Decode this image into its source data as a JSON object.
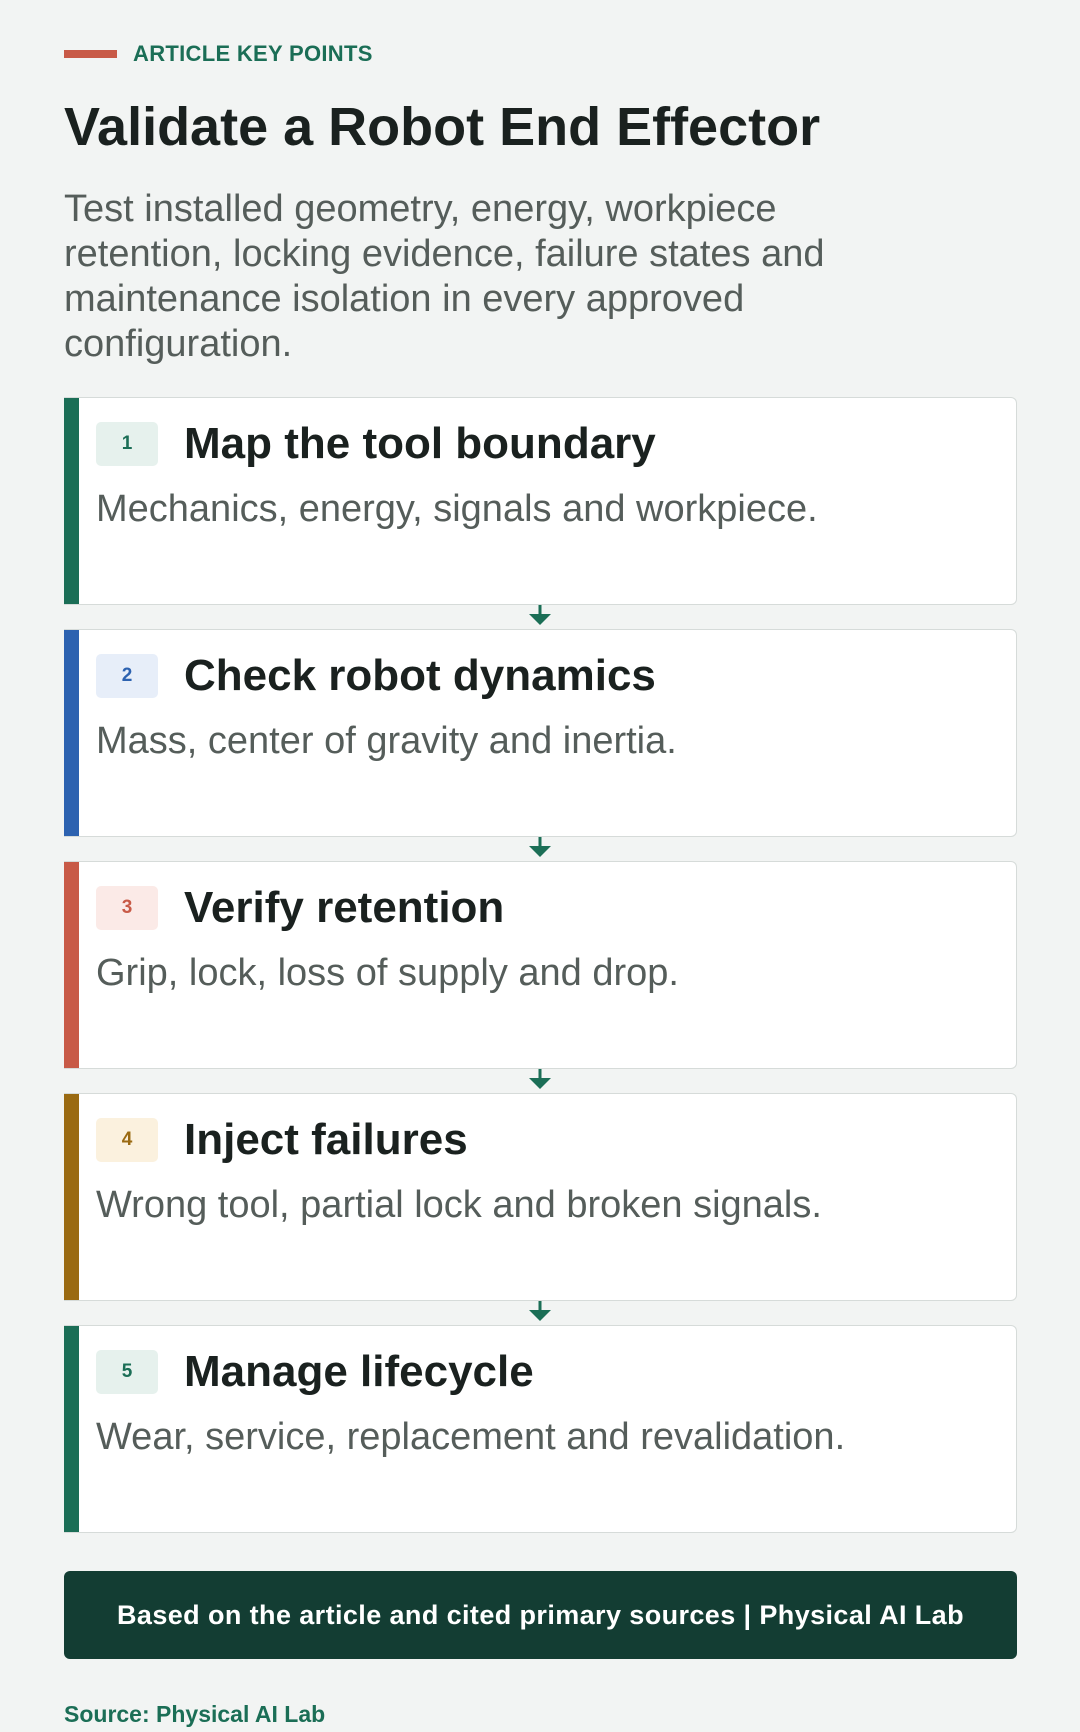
{
  "header": {
    "kicker": "ARTICLE KEY POINTS",
    "title": "Validate a Robot End Effector",
    "subtitle": "Test installed geometry, energy, workpiece retention, locking evidence, failure states and maintenance isolation in every approved configuration."
  },
  "colors": {
    "kicker_bar": "#c85a47",
    "accent_green": "#1b6e56",
    "accent_blue": "#2d62b0",
    "accent_red": "#c85a47",
    "accent_gold": "#9a6a12",
    "footer_bg": "#133d33"
  },
  "steps": [
    {
      "number": "1",
      "title": "Map the tool boundary",
      "description": "Mechanics, energy, signals and workpiece.",
      "accent": "#1b6e56",
      "badge_bg": "#e6f1ed",
      "badge_fg": "#1b6e56"
    },
    {
      "number": "2",
      "title": "Check robot dynamics",
      "description": "Mass, center of gravity and inertia.",
      "accent": "#2d62b0",
      "badge_bg": "#e7eef9",
      "badge_fg": "#2d62b0"
    },
    {
      "number": "3",
      "title": "Verify retention",
      "description": "Grip, lock, loss of supply and drop.",
      "accent": "#c85a47",
      "badge_bg": "#fbeae7",
      "badge_fg": "#c85a47"
    },
    {
      "number": "4",
      "title": "Inject failures",
      "description": "Wrong tool, partial lock and broken signals.",
      "accent": "#9a6a12",
      "badge_bg": "#fbf1de",
      "badge_fg": "#9a6a12"
    },
    {
      "number": "5",
      "title": "Manage lifecycle",
      "description": "Wear, service, replacement and revalidation.",
      "accent": "#1b6e56",
      "badge_bg": "#e6f1ed",
      "badge_fg": "#1b6e56"
    }
  ],
  "footer": {
    "banner": "Based on the article and cited primary sources | Physical AI Lab",
    "source": "Source: Physical AI Lab"
  }
}
